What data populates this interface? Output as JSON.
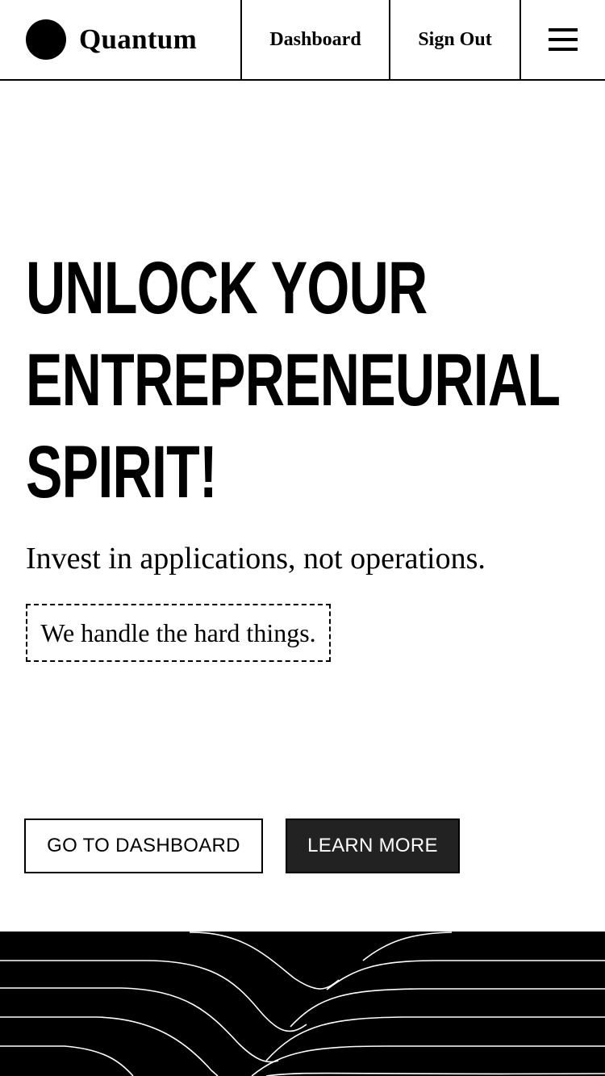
{
  "header": {
    "brand_name": "Quantum",
    "nav": {
      "dashboard": "Dashboard",
      "sign_out": "Sign Out"
    }
  },
  "hero": {
    "title_lines": [
      "UNLOCK YOUR",
      "ENTREPRENEURIAL",
      "SPIRIT!"
    ],
    "subtitle": "Invest in applications, not operations.",
    "tagline": "We handle the hard things."
  },
  "actions": {
    "primary": "GO TO DASHBOARD",
    "secondary": "LEARN MORE"
  },
  "colors": {
    "text": "#000000",
    "background": "#ffffff",
    "secondary_button_bg": "#222222",
    "footer_bg": "#000000",
    "wave_lines": "#ffffff"
  },
  "icons": {
    "logo": "filled-circle-logo",
    "menu": "hamburger-menu-icon"
  }
}
